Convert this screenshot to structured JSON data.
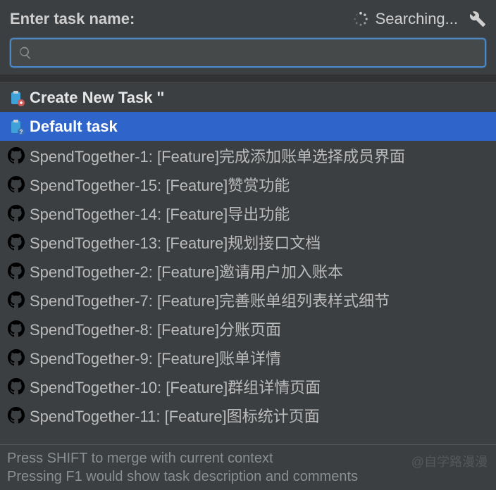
{
  "header": {
    "label": "Enter task name:",
    "status_text": "Searching...",
    "wrench_icon": "wrench-icon",
    "spinner_icon": "spinner-icon"
  },
  "search": {
    "value": "",
    "placeholder": ""
  },
  "list": {
    "items": [
      {
        "kind": "create",
        "icon": "clipboard-new-icon",
        "label": "Create New Task ''",
        "selected": false
      },
      {
        "kind": "default",
        "icon": "clipboard-q-icon",
        "label": "Default task",
        "selected": true
      },
      {
        "kind": "issue",
        "icon": "github-icon",
        "label": "SpendTogether-1: [Feature]完成添加账单选择成员界面",
        "selected": false
      },
      {
        "kind": "issue",
        "icon": "github-icon",
        "label": "SpendTogether-15: [Feature]赞赏功能",
        "selected": false
      },
      {
        "kind": "issue",
        "icon": "github-icon",
        "label": "SpendTogether-14: [Feature]导出功能",
        "selected": false
      },
      {
        "kind": "issue",
        "icon": "github-icon",
        "label": "SpendTogether-13: [Feature]规划接口文档",
        "selected": false
      },
      {
        "kind": "issue",
        "icon": "github-icon",
        "label": "SpendTogether-2: [Feature]邀请用户加入账本",
        "selected": false
      },
      {
        "kind": "issue",
        "icon": "github-icon",
        "label": "SpendTogether-7: [Feature]完善账单组列表样式细节",
        "selected": false
      },
      {
        "kind": "issue",
        "icon": "github-icon",
        "label": "SpendTogether-8: [Feature]分账页面",
        "selected": false
      },
      {
        "kind": "issue",
        "icon": "github-icon",
        "label": "SpendTogether-9: [Feature]账单详情",
        "selected": false
      },
      {
        "kind": "issue",
        "icon": "github-icon",
        "label": "SpendTogether-10: [Feature]群组详情页面",
        "selected": false
      },
      {
        "kind": "issue",
        "icon": "github-icon",
        "label": "SpendTogether-11: [Feature]图标统计页面",
        "selected": false
      }
    ]
  },
  "footer": {
    "line1": "Press SHIFT to merge with current context",
    "line2": "Pressing F1 would show task description and comments"
  },
  "watermark": "@自学路漫漫"
}
